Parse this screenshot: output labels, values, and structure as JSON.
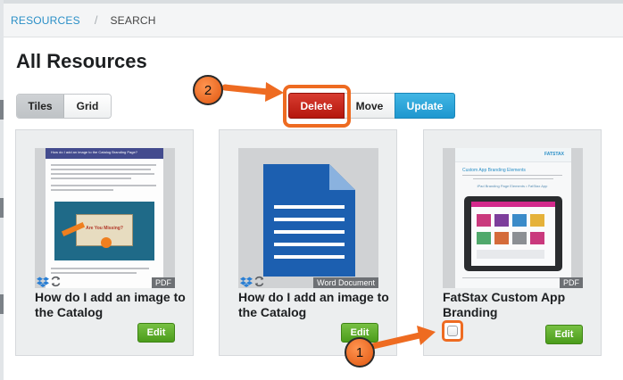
{
  "breadcrumb": {
    "link": "RESOURCES",
    "separator": "/",
    "current": "SEARCH"
  },
  "page_title": "All Resources",
  "view_toggle": {
    "tiles": "Tiles",
    "grid": "Grid",
    "active": "tiles"
  },
  "actions": {
    "delete": "Delete",
    "move": "Move",
    "update": "Update"
  },
  "tiles": [
    {
      "title": "How do I add an image to the Catalog",
      "badge": "PDF",
      "edit": "Edit",
      "thumb_heading": "How do I add an image to the Catalog Branding Page?",
      "thumb_subtitle": "Are You Missing?"
    },
    {
      "title": "How do I add an image to the Catalog",
      "badge": "Word Document",
      "edit": "Edit"
    },
    {
      "title": "FatStax Custom App Branding",
      "badge": "PDF",
      "edit": "Edit",
      "thumb_logo": "FATSTAX",
      "thumb_heading": "Custom App Branding Elements",
      "thumb_tagline": "iPad Branding Page Elements • FatStax App"
    }
  ],
  "callouts": {
    "two": "2",
    "one": "1"
  },
  "colors": {
    "accent_link": "#2a8fc7",
    "delete": "#c92417",
    "update": "#2fa7dc",
    "edit": "#5fac2e",
    "annotation": "#ee6b21"
  }
}
